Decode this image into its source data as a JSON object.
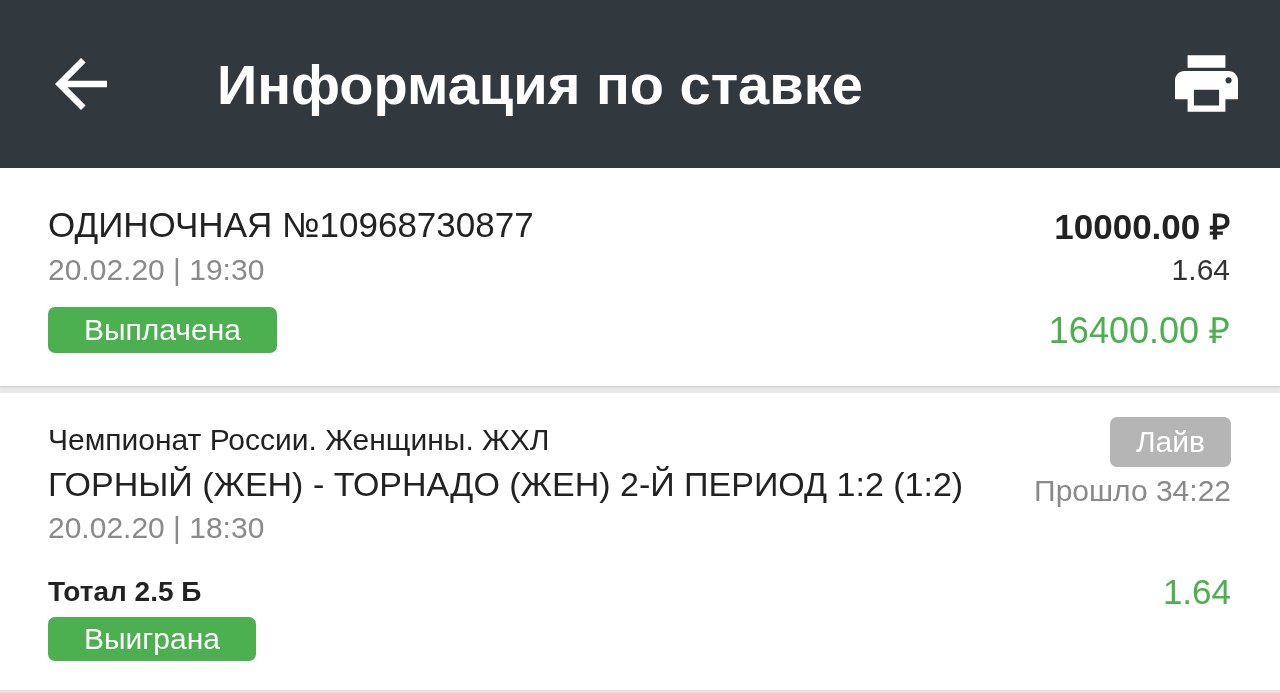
{
  "header": {
    "title": "Информация по ставке"
  },
  "bet": {
    "title": "ОДИНОЧНАЯ №10968730877",
    "date": "20.02.20 | 19:30",
    "status": {
      "label": "Выплачена",
      "kind": "paid"
    },
    "stake": "10000.00 ₽",
    "odds": "1.64",
    "payout": "16400.00 ₽"
  },
  "events": [
    {
      "league": "Чемпионат России. Женщины. ЖХЛ",
      "match": "ГОРНЫЙ (ЖЕН) - ТОРНАДО (ЖЕН) 2-Й ПЕРИОД 1:2 (1:2)",
      "date": "20.02.20 | 18:30",
      "live": {
        "label": "Лайв",
        "kind": "live"
      },
      "elapsed": "Прошло 34:22",
      "selection": "Тотал 2.5 Б",
      "odds": "1.64",
      "status": {
        "label": "Выиграна",
        "kind": "won"
      }
    }
  ]
}
